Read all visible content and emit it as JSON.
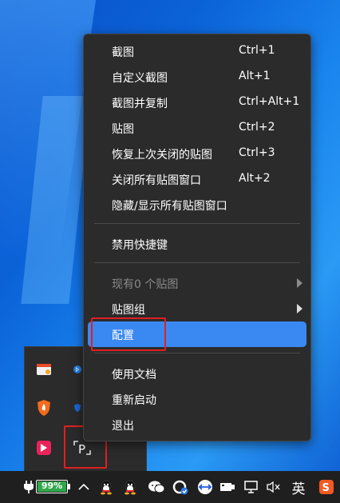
{
  "menu": {
    "items": [
      {
        "label": "截图",
        "shortcut": "Ctrl+1"
      },
      {
        "label": "自定义截图",
        "shortcut": "Alt+1"
      },
      {
        "label": "截图并复制",
        "shortcut": "Ctrl+Alt+1"
      },
      {
        "label": "贴图",
        "shortcut": "Ctrl+2"
      },
      {
        "label": "恢复上次关闭的贴图",
        "shortcut": "Ctrl+3"
      },
      {
        "label": "关闭所有贴图窗口",
        "shortcut": "Alt+2"
      },
      {
        "label": "隐藏/显示所有贴图窗口",
        "shortcut": ""
      },
      {
        "label": "禁用快捷键",
        "shortcut": ""
      },
      {
        "label": "现有0 个贴图",
        "shortcut": "",
        "disabled": true,
        "submenu": true
      },
      {
        "label": "贴图组",
        "shortcut": "",
        "submenu": true
      },
      {
        "label": "配置",
        "shortcut": "",
        "highlighted": true
      },
      {
        "label": "使用文档",
        "shortcut": ""
      },
      {
        "label": "重新启动",
        "shortcut": ""
      },
      {
        "label": "退出",
        "shortcut": ""
      }
    ]
  },
  "taskbar": {
    "battery_percent": "99%",
    "battery_level": 0.99,
    "ime_label": "英"
  },
  "tray_popup": {
    "icons": [
      "browser-app-icon",
      "bluetooth-icon",
      "shield-security-icon",
      "defender-icon",
      "red-app-icon",
      "snipaste-icon"
    ]
  },
  "colors": {
    "menu_bg": "#2b2b2b",
    "highlight": "#3a89f3",
    "annotation_red": "#e02020",
    "battery_green": "#2fa84a"
  }
}
